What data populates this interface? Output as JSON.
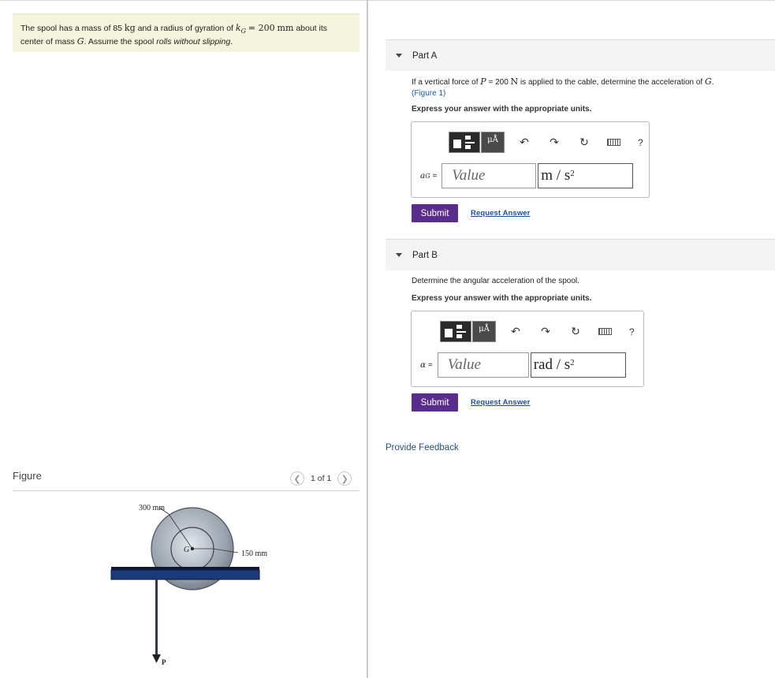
{
  "problem": {
    "t1": "The spool has a mass of 85",
    "kg": "kg",
    "t2": "and a radius of gyration of",
    "kvar": "k",
    "ksub": "G",
    "eq": "= 200",
    "mm": "mm",
    "t3": "about its",
    "t4": "center of mass",
    "G": "G",
    "t5": ". Assume the spool",
    "t6": "rolls without slipping",
    "t7": "."
  },
  "figure": {
    "label": "Figure",
    "counter": "1 of 1",
    "prev_icon": "chevron-left-icon",
    "next_icon": "chevron-right-icon",
    "dim_outer": "300 mm",
    "dim_inner": "150 mm",
    "center_label": "G",
    "force_label": "P"
  },
  "partA": {
    "title": "Part A",
    "q1": "If a vertical force of",
    "P": "P",
    "q2": "= 200",
    "N": "N",
    "q3": "is applied to the cable, determine the acceleration of",
    "G": "G",
    "q4": ".",
    "figref": "(Figure 1)",
    "instruction": "Express your answer with the appropriate units.",
    "var": "a",
    "var_sub": "G",
    "eq": "=",
    "value_placeholder": "Value",
    "unit": "m / s",
    "unit_exp": "2",
    "submit": "Submit",
    "request": "Request Answer"
  },
  "partB": {
    "title": "Part B",
    "question": "Determine the angular acceleration of the spool.",
    "instruction": "Express your answer with the appropriate units.",
    "var": "α",
    "eq": "=",
    "value_placeholder": "Value",
    "unit": "rad / s",
    "unit_exp": "2",
    "submit": "Submit",
    "request": "Request Answer"
  },
  "toolbar": {
    "mu": "μÅ",
    "undo_icon": "↶",
    "redo_icon": "↷",
    "reset_icon": "↻",
    "help": "?"
  },
  "feedback": "Provide Feedback"
}
